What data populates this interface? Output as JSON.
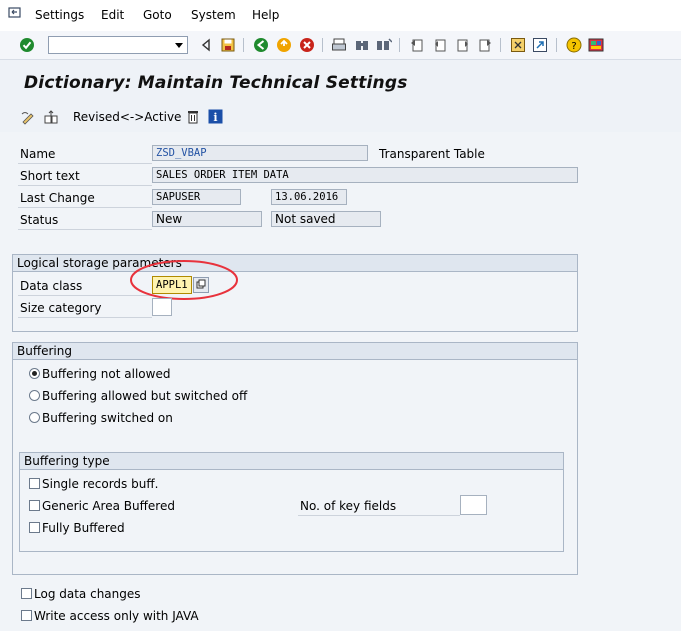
{
  "menu": {
    "items": [
      "Settings",
      "Edit",
      "Goto",
      "System",
      "Help"
    ]
  },
  "toolbar": {
    "command_value": "",
    "icons": [
      "enter-icon",
      "back-icon",
      "save-icon",
      "back-green-icon",
      "exit-icon",
      "cancel-icon",
      "print-icon",
      "find-icon",
      "find-next-icon",
      "first-page-icon",
      "prev-page-icon",
      "next-page-icon",
      "last-page-icon",
      "create-session-icon",
      "shortcut-icon",
      "help-icon",
      "layout-icon"
    ]
  },
  "header": {
    "title": "Dictionary: Maintain Technical Settings"
  },
  "app_toolbar": {
    "revised_active_label": "Revised<->Active"
  },
  "form": {
    "name_label": "Name",
    "name_value": "ZSD_VBAP",
    "table_type": "Transparent Table",
    "short_text_label": "Short text",
    "short_text_value": "SALES ORDER ITEM DATA",
    "last_change_label": "Last Change",
    "last_change_user": "SAPUSER",
    "last_change_date": "13.06.2016",
    "status_label": "Status",
    "status_value": "New",
    "status_save": "Not saved"
  },
  "logical_storage": {
    "title": "Logical storage parameters",
    "data_class_label": "Data class",
    "data_class_value": "APPL1",
    "size_category_label": "Size category",
    "size_category_value": ""
  },
  "buffering": {
    "title": "Buffering",
    "options": [
      "Buffering not allowed",
      "Buffering allowed but switched off",
      "Buffering switched on"
    ],
    "selected_index": 0,
    "type_title": "Buffering type",
    "types": [
      "Single records buff.",
      "Generic Area Buffered",
      "Fully Buffered"
    ],
    "key_fields_label": "No. of key fields",
    "key_fields_value": ""
  },
  "extra": {
    "log_changes": "Log data changes",
    "java_only": "Write access only with JAVA"
  },
  "colors": {
    "highlight_ellipse": "#e8323c",
    "field_highlight": "#fff4b0"
  }
}
